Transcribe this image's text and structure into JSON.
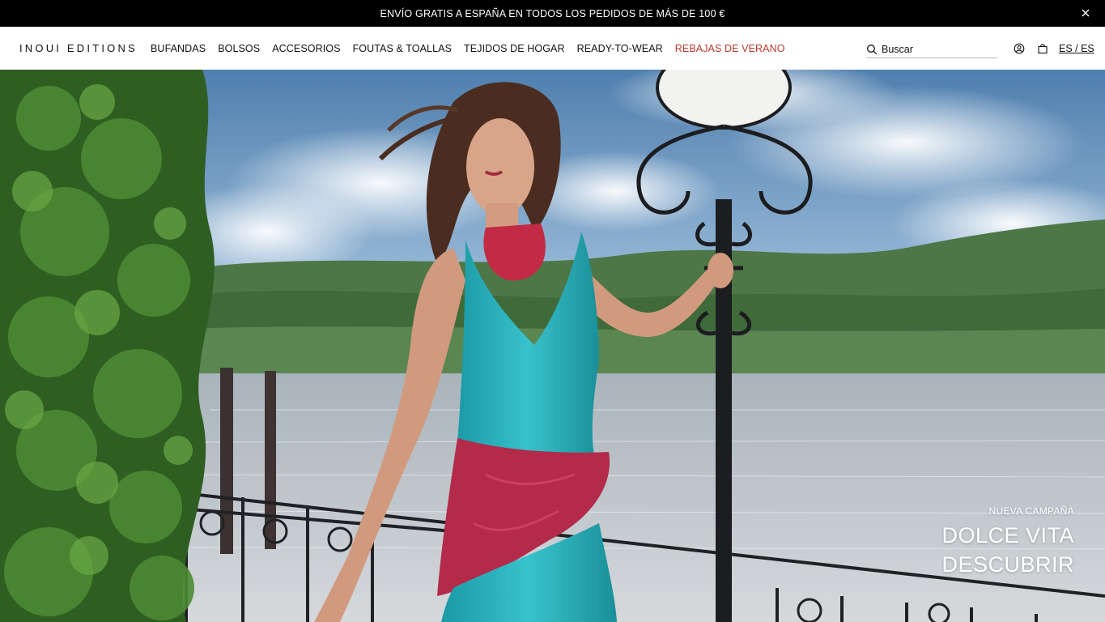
{
  "announcement": {
    "text": "ENVÍO GRATIS A ESPAÑA EN TODOS LOS PEDIDOS DE MÁS DE 100 €",
    "close_icon": "close-icon"
  },
  "header": {
    "logo": "INOUI EDITIONS",
    "nav": [
      {
        "label": "BUFANDAS"
      },
      {
        "label": "BOLSOS"
      },
      {
        "label": "ACCESORIOS"
      },
      {
        "label": "FOUTAS & TOALLAS"
      },
      {
        "label": "TEJIDOS DE HOGAR"
      },
      {
        "label": "READY-TO-WEAR"
      },
      {
        "label": "REBAJAS DE VERANO",
        "color": "#c0392b"
      }
    ],
    "search": {
      "placeholder": "Buscar",
      "icon": "search-icon"
    },
    "account_icon": "user-icon",
    "cart_icon": "bag-icon",
    "language": "ES / ES"
  },
  "hero": {
    "eyebrow": "NUEVA CAMPAÑA",
    "title": "DOLCE VITA",
    "cta": "DESCUBRIR"
  },
  "colors": {
    "announcement_bg": "#000000",
    "sale_link": "#c0392b",
    "hero_text": "#ffffff"
  }
}
